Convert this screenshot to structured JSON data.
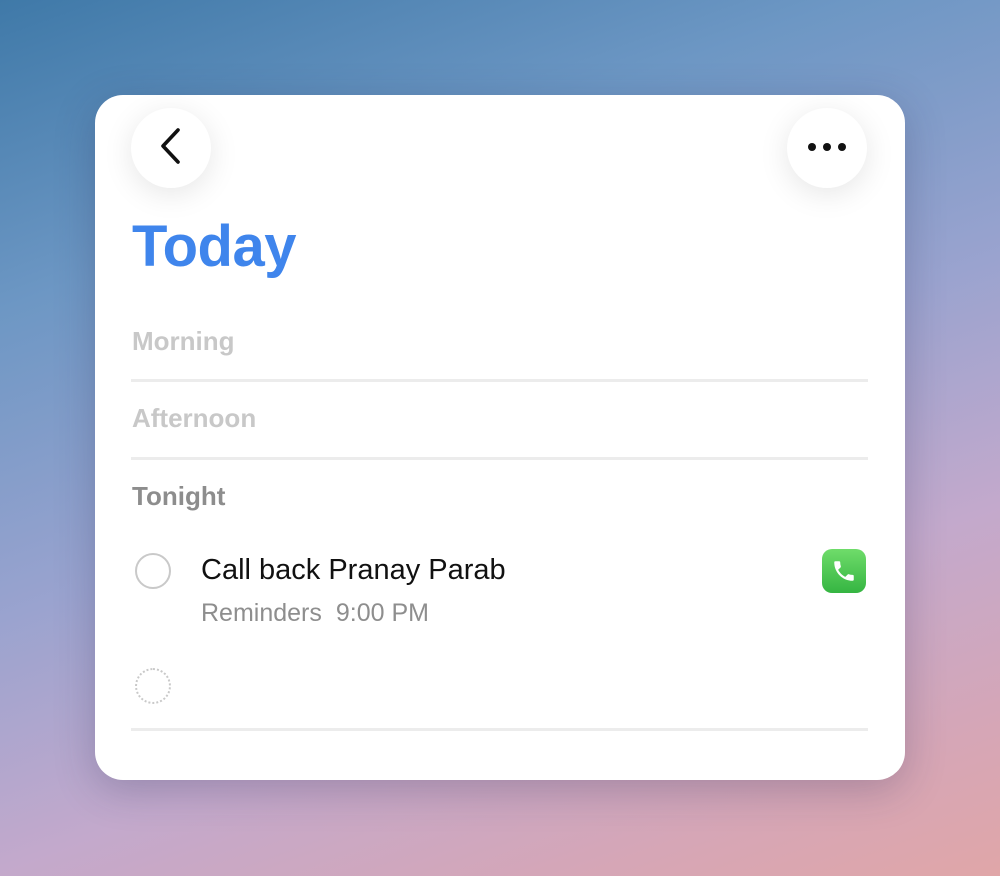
{
  "header": {
    "back_icon": "chevron-left-icon",
    "more_icon": "ellipsis-icon"
  },
  "page": {
    "title": "Today"
  },
  "sections": {
    "morning": "Morning",
    "afternoon": "Afternoon",
    "tonight": "Tonight"
  },
  "tasks": [
    {
      "title": "Call back Pranay Parab",
      "list": "Reminders",
      "time": "9:00 PM",
      "app_icon": "phone-icon"
    }
  ],
  "colors": {
    "title": "#3f85ec",
    "phone_green": "#35b542"
  }
}
